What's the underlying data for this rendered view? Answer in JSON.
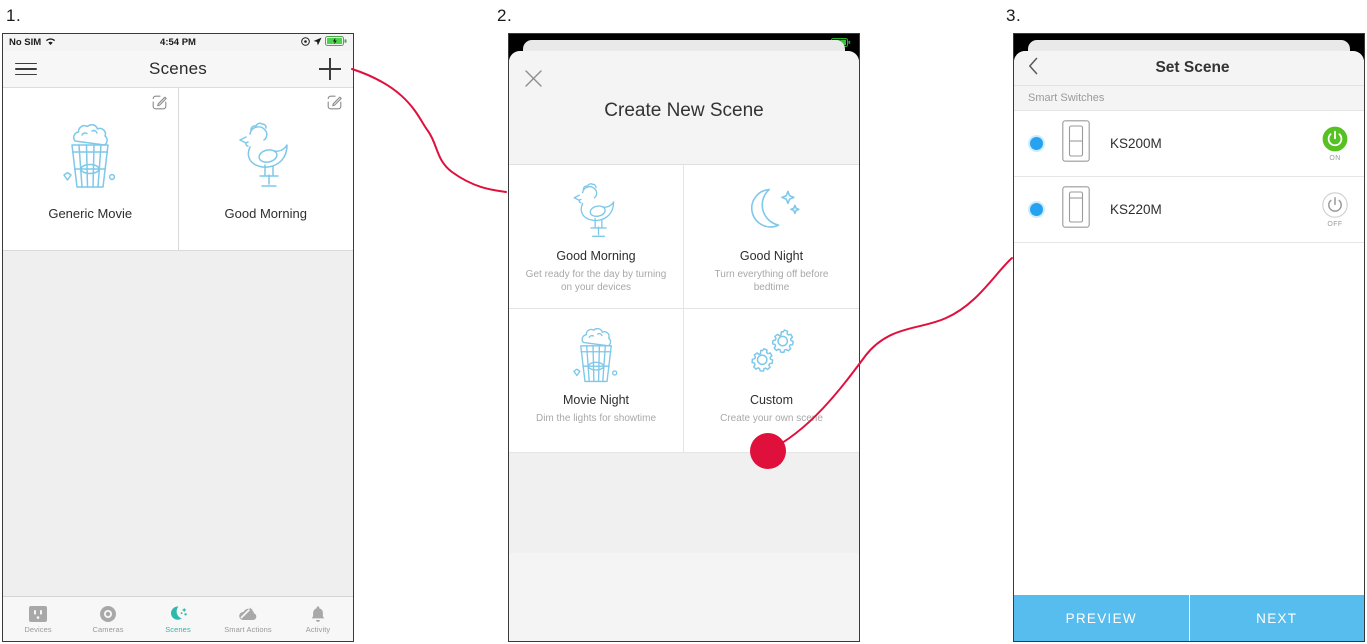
{
  "steps": [
    {
      "label": "1."
    },
    {
      "label": "2."
    },
    {
      "label": "3."
    }
  ],
  "colors": {
    "accent_blue": "#57bdee",
    "icon_blue": "#7ec8ea",
    "active_tab_teal": "#2fb8ae",
    "radio_blue": "#25a3f0",
    "power_on_green": "#56c122",
    "connector_red": "#e0103c",
    "marker_red": "#e0103c"
  },
  "phone1": {
    "status_bar": {
      "carrier": "No SIM",
      "wifi_icon": "wifi-icon",
      "time": "4:54 PM",
      "alarm_icon": "alarm-icon",
      "location_icon": "location-arrow-icon",
      "battery_icon": "battery-charging-icon"
    },
    "nav": {
      "menu_icon": "hamburger-menu-icon",
      "title": "Scenes",
      "add_icon": "plus-icon"
    },
    "scenes": [
      {
        "name": "Generic Movie",
        "art": "popcorn-icon",
        "edit_icon": "edit-pencil-icon"
      },
      {
        "name": "Good Morning",
        "art": "rooster-icon",
        "edit_icon": "edit-pencil-icon"
      }
    ],
    "tabs": [
      {
        "label": "Devices",
        "icon": "outlet-icon",
        "active": false
      },
      {
        "label": "Cameras",
        "icon": "camera-icon",
        "active": false
      },
      {
        "label": "Scenes",
        "icon": "moon-stars-icon",
        "active": true
      },
      {
        "label": "Smart Actions",
        "icon": "magic-wand-cloud-icon",
        "active": false
      },
      {
        "label": "Activity",
        "icon": "bell-icon",
        "active": false
      }
    ]
  },
  "phone2": {
    "status_bar": {
      "battery_icon": "battery-charging-icon"
    },
    "sheet": {
      "close_icon": "close-x-icon",
      "title": "Create New Scene"
    },
    "tiles": [
      {
        "name": "Good Morning",
        "desc": "Get ready for the day by turning on your devices",
        "art": "rooster-icon"
      },
      {
        "name": "Good Night",
        "desc": "Turn everything off before bedtime",
        "art": "moon-stars-icon"
      },
      {
        "name": "Movie Night",
        "desc": "Dim the lights for showtime",
        "art": "popcorn-icon"
      },
      {
        "name": "Custom",
        "desc": "Create your own scene",
        "art": "gears-icon",
        "marker": true
      }
    ]
  },
  "phone3": {
    "nav": {
      "back_icon": "chevron-left-icon",
      "title": "Set Scene"
    },
    "section_header": "Smart Switches",
    "devices": [
      {
        "name": "KS200M",
        "radio_icon": "radio-selected-icon",
        "thumb_icon": "smart-switch-icon",
        "power_icon": "power-icon",
        "power_label": "ON",
        "power_state": "on"
      },
      {
        "name": "KS220M",
        "radio_icon": "radio-selected-icon",
        "thumb_icon": "smart-dimmer-icon",
        "power_icon": "power-icon",
        "power_label": "OFF",
        "power_state": "off"
      }
    ],
    "footer_buttons": [
      {
        "label": "PREVIEW"
      },
      {
        "label": "NEXT"
      }
    ]
  }
}
